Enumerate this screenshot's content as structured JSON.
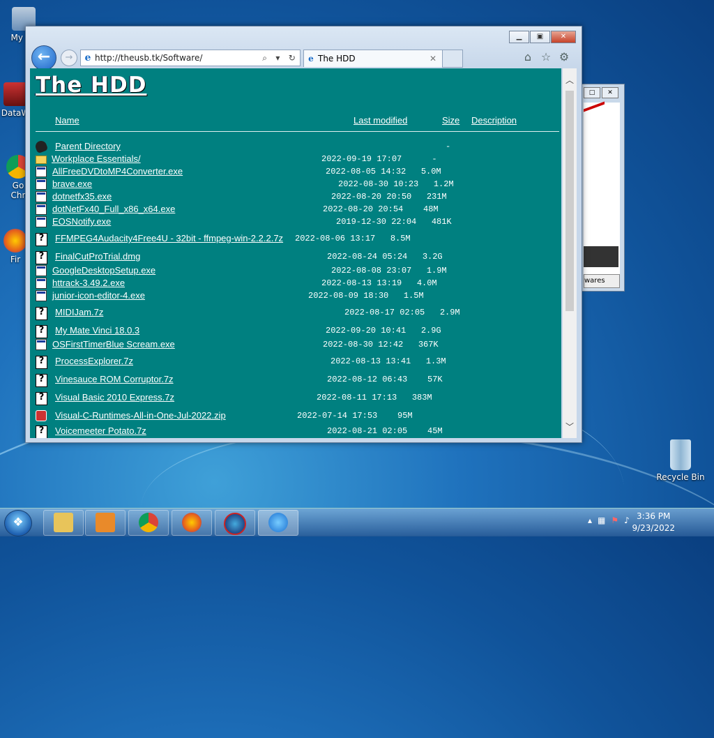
{
  "desktop": {
    "icons": [
      {
        "label": "My Co",
        "icon": "computer-icon"
      },
      {
        "label": "DataW",
        "icon": "shortcut-icon"
      },
      {
        "label": "Go\nChr",
        "icon": "chrome-icon"
      },
      {
        "label": "Fir",
        "icon": "firefox-icon"
      }
    ],
    "recycle_bin": {
      "label": "Recycle Bin",
      "icon": "recycle-bin-icon"
    }
  },
  "back_window": {
    "button_label": "wares"
  },
  "browser": {
    "address": "http://theusb.tk/Software/",
    "tab_title": "The HDD",
    "page": {
      "title": "The HDD",
      "columns": {
        "name": "Name",
        "modified": "Last modified",
        "size": "Size",
        "description": "Description"
      },
      "rows": [
        {
          "icon": "back",
          "name": "Parent Directory",
          "date": "",
          "size": "-"
        },
        {
          "icon": "folder",
          "name": "Workplace Essentials/",
          "date": "2022-09-19 17:07",
          "size": "-"
        },
        {
          "icon": "exe",
          "name": "AllFreeDVDtoMP4Converter.exe",
          "date": "2022-08-05 14:32",
          "size": "5.0M"
        },
        {
          "icon": "exe",
          "name": "brave.exe",
          "date": "2022-08-30 10:23",
          "size": "1.2M"
        },
        {
          "icon": "exe",
          "name": "dotnetfx35.exe",
          "date": "2022-08-20 20:50",
          "size": "231M"
        },
        {
          "icon": "exe",
          "name": "dotNetFx40_Full_x86_x64.exe",
          "date": "2022-08-20 20:54",
          "size": "48M"
        },
        {
          "icon": "exe",
          "name": "EOSNotify.exe",
          "date": "2019-12-30 22:04",
          "size": "481K"
        },
        {
          "icon": "q",
          "name": "FFMPEG4Audacity4Free4U - 32bit - ffmpeg-win-2.2.2.7z",
          "date": "2022-08-06 13:17",
          "size": "8.5M"
        },
        {
          "icon": "q",
          "name": "FinalCutProTrial.dmg",
          "date": "2022-08-24 05:24",
          "size": "3.2G"
        },
        {
          "icon": "exe",
          "name": "GoogleDesktopSetup.exe",
          "date": "2022-08-08 23:07",
          "size": "1.9M"
        },
        {
          "icon": "exe",
          "name": "httrack-3.49.2.exe",
          "date": "2022-08-13 13:19",
          "size": "4.0M"
        },
        {
          "icon": "exe",
          "name": "junior-icon-editor-4.exe",
          "date": "2022-08-09 18:30",
          "size": "1.5M"
        },
        {
          "icon": "q",
          "name": "MIDIJam.7z",
          "date": "2022-08-17 02:05",
          "size": "2.9M"
        },
        {
          "icon": "q",
          "name": "My Mate Vinci 18.0.3",
          "date": "2022-09-20 10:41",
          "size": "2.9G"
        },
        {
          "icon": "exe",
          "name": "OSFirstTimerBlue Scream.exe",
          "date": "2022-08-30 12:42",
          "size": "367K"
        },
        {
          "icon": "q",
          "name": "ProcessExplorer.7z",
          "date": "2022-08-13 13:41",
          "size": "1.3M"
        },
        {
          "icon": "q",
          "name": "Vinesauce ROM Corruptor.7z",
          "date": "2022-08-12 06:43",
          "size": "57K"
        },
        {
          "icon": "q",
          "name": "Visual Basic 2010 Express.7z",
          "date": "2022-08-11 17:13",
          "size": "383M"
        },
        {
          "icon": "zip",
          "name": "Visual-C-Runtimes-All-in-One-Jul-2022.zip",
          "date": "2022-07-14 17:53",
          "size": "95M"
        },
        {
          "icon": "q",
          "name": "Voicemeeter Potato.7z",
          "date": "2022-08-21 02:05",
          "size": "45M"
        }
      ]
    }
  },
  "taskbar": {
    "apps": [
      "file-explorer",
      "media-player",
      "chrome",
      "firefox",
      "app-feather",
      "internet-explorer"
    ],
    "time": "3:36 PM",
    "date": "9/23/2022"
  }
}
